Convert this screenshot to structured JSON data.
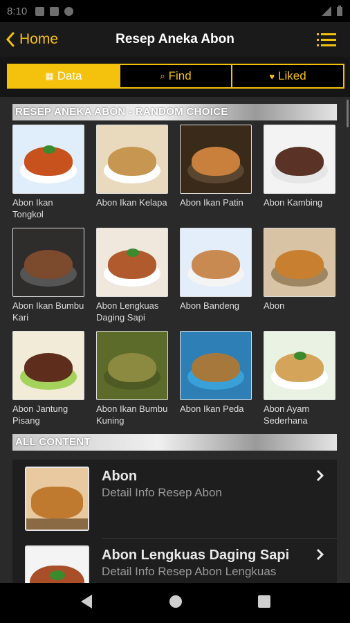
{
  "status_bar": {
    "time": "8:10"
  },
  "app_bar": {
    "back_label": "Home",
    "title": "Resep Aneka Abon"
  },
  "tabs": [
    {
      "label": "Data",
      "icon": "grid-icon",
      "active": true
    },
    {
      "label": "Find",
      "icon": "search-icon",
      "active": false
    },
    {
      "label": "Liked",
      "icon": "heart-icon",
      "active": false
    }
  ],
  "random_section": {
    "header": "RESEP ANEKA ABON - RANDOM CHOICE"
  },
  "grid_items": [
    {
      "label": "Abon Ikan Tongkol",
      "bg": "#dfeefa",
      "food": "#c8521e",
      "plate": "#ffffff"
    },
    {
      "label": "Abon Ikan Kelapa",
      "bg": "#e9d9bd",
      "food": "#c79650",
      "plate": "#ffffff"
    },
    {
      "label": "Abon Ikan Patin",
      "bg": "#3a2a1a",
      "food": "#c8803c",
      "plate": "#5a4530"
    },
    {
      "label": "Abon Kambing",
      "bg": "#f3f3f3",
      "food": "#5a3326",
      "plate": "#e6e6e6"
    },
    {
      "label": "Abon Ikan Bumbu Kari",
      "bg": "#2f2d2b",
      "food": "#7c4a2c",
      "plate": "#555555"
    },
    {
      "label": "Abon Lengkuas Daging Sapi",
      "bg": "#f0e7dd",
      "food": "#b05a2e",
      "plate": "#ffffff"
    },
    {
      "label": "Abon Bandeng",
      "bg": "#e3eefa",
      "food": "#c98a52",
      "plate": "#f4f4f4"
    },
    {
      "label": "Abon",
      "bg": "#d8c3a4",
      "food": "#c88030",
      "plate": "#9e8662"
    },
    {
      "label": "Abon Jantung Pisang",
      "bg": "#f1ebd8",
      "food": "#5e2d1c",
      "plate": "#a4d25a"
    },
    {
      "label": "Abon Ikan Bumbu Kuning",
      "bg": "#5c6a2a",
      "food": "#8c8a40",
      "plate": "#4d5a24"
    },
    {
      "label": "Abon Ikan Peda",
      "bg": "#2d7fb5",
      "food": "#a6783c",
      "plate": "#3aa0d8"
    },
    {
      "label": "Abon Ayam Sederhana",
      "bg": "#eaf2e4",
      "food": "#d4a45a",
      "plate": "#ffffff"
    }
  ],
  "all_section": {
    "header": "ALL CONTENT"
  },
  "list_items": [
    {
      "title": "Abon",
      "subtitle": "Detail Info Resep Abon"
    },
    {
      "title": "Abon Lengkuas Daging Sapi",
      "subtitle": "Detail Info Resep Abon Lengkuas"
    }
  ],
  "colors": {
    "accent": "#f4c20d",
    "background": "#2a2a2a",
    "header_bg": "#1a1a1a"
  }
}
